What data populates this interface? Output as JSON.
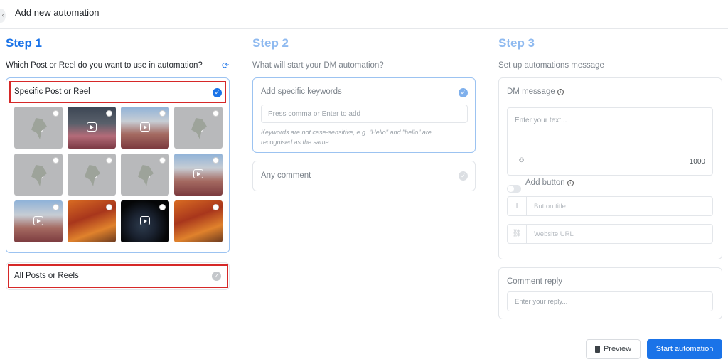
{
  "header": {
    "title": "Add new automation"
  },
  "step1": {
    "title": "Step 1",
    "question": "Which Post or Reel do you want to use in automation?",
    "option_specific": "Specific Post or Reel",
    "option_all": "All Posts or Reels",
    "thumbnails": [
      {
        "kind": "map"
      },
      {
        "kind": "portrait"
      },
      {
        "kind": "city"
      },
      {
        "kind": "map"
      },
      {
        "kind": "map"
      },
      {
        "kind": "map"
      },
      {
        "kind": "map"
      },
      {
        "kind": "city"
      },
      {
        "kind": "city"
      },
      {
        "kind": "autumn"
      },
      {
        "kind": "moon"
      },
      {
        "kind": "autumn"
      }
    ]
  },
  "step2": {
    "title": "Step 2",
    "question": "What will start your DM automation?",
    "option_keywords": "Add specific keywords",
    "keywords_placeholder": "Press comma or Enter to add",
    "keywords_hint": "Keywords are not case-sensitive, e.g. \"Hello\" and \"hello\" are recognised as the same.",
    "option_any": "Any comment"
  },
  "step3": {
    "title": "Step 3",
    "question": "Set up automations message",
    "dm_label": "DM message",
    "dm_placeholder": "Enter your text...",
    "char_count": "1000",
    "add_button_label": "Add button",
    "button_title_placeholder": "Button title",
    "website_url_placeholder": "Website URL",
    "comment_reply_label": "Comment reply",
    "reply_placeholder": "Enter your reply..."
  },
  "footer": {
    "preview_label": "Preview",
    "start_label": "Start automation"
  },
  "colors": {
    "accent": "#1a73e8",
    "highlight": "#d62828"
  }
}
